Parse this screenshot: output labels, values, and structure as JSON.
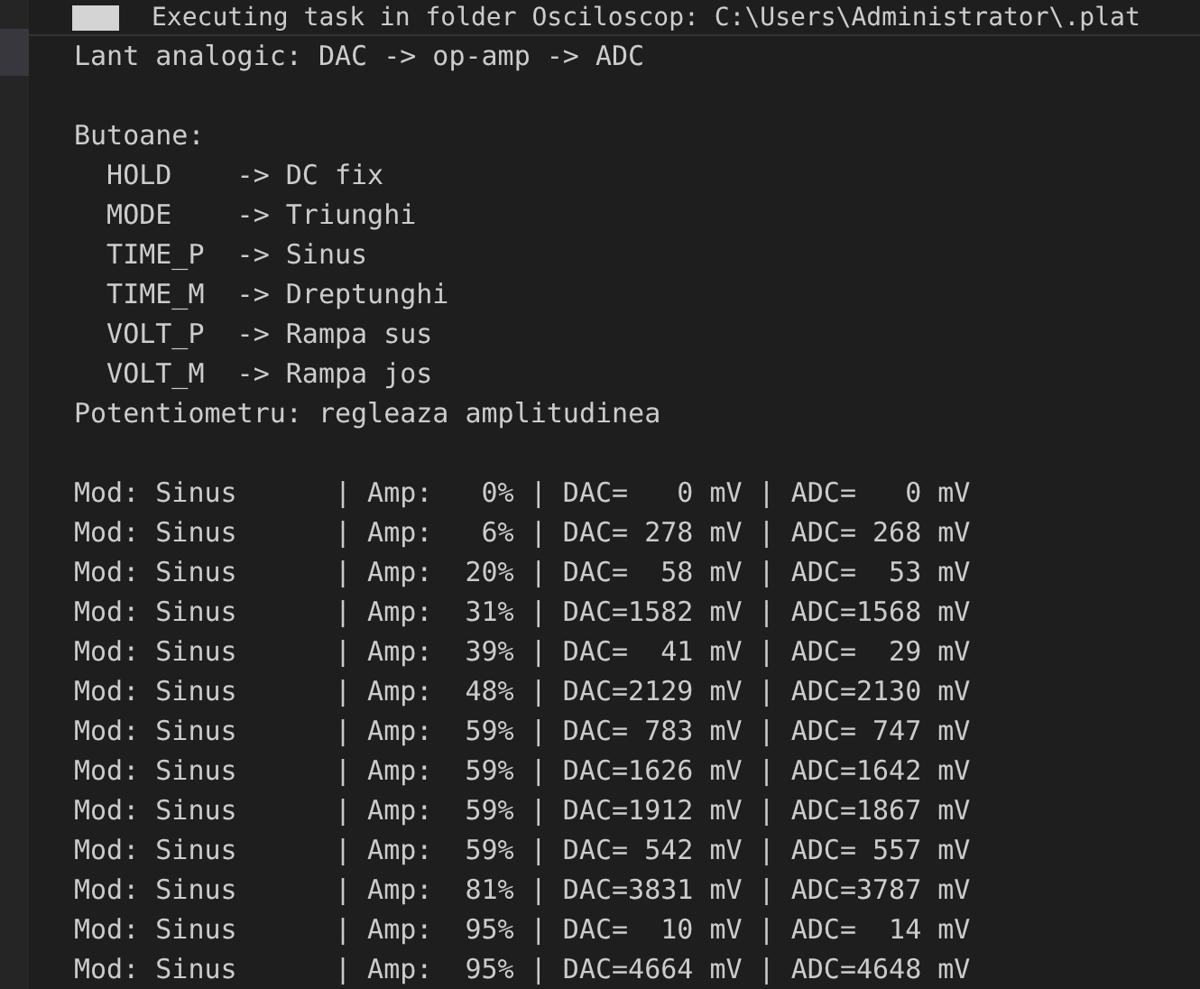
{
  "task_banner": {
    "text": "Executing task in folder Osciloscop: C:\\Users\\Administrator\\.plat"
  },
  "blocks": [
    {
      "lines": [
        "Lant analogic: DAC -> op-amp -> ADC"
      ]
    },
    {
      "lines": [
        "Butoane:",
        "  HOLD    -> DC fix",
        "  MODE    -> Triunghi",
        "  TIME_P  -> Sinus",
        "  TIME_M  -> Dreptunghi",
        "  VOLT_P  -> Rampa sus",
        "  VOLT_M  -> Rampa jos",
        "Potentiometru: regleaza amplitudinea"
      ]
    },
    {
      "lines": [
        "Mod: Sinus      | Amp:   0% | DAC=   0 mV | ADC=   0 mV",
        "Mod: Sinus      | Amp:   6% | DAC= 278 mV | ADC= 268 mV",
        "Mod: Sinus      | Amp:  20% | DAC=  58 mV | ADC=  53 mV",
        "Mod: Sinus      | Amp:  31% | DAC=1582 mV | ADC=1568 mV",
        "Mod: Sinus      | Amp:  39% | DAC=  41 mV | ADC=  29 mV",
        "Mod: Sinus      | Amp:  48% | DAC=2129 mV | ADC=2130 mV",
        "Mod: Sinus      | Amp:  59% | DAC= 783 mV | ADC= 747 mV",
        "Mod: Sinus      | Amp:  59% | DAC=1626 mV | ADC=1642 mV",
        "Mod: Sinus      | Amp:  59% | DAC=1912 mV | ADC=1867 mV",
        "Mod: Sinus      | Amp:  59% | DAC= 542 mV | ADC= 557 mV",
        "Mod: Sinus      | Amp:  81% | DAC=3831 mV | ADC=3787 mV",
        "Mod: Sinus      | Amp:  95% | DAC=  10 mV | ADC=  14 mV",
        "Mod: Sinus      | Amp:  95% | DAC=4664 mV | ADC=4648 mV"
      ]
    }
  ]
}
